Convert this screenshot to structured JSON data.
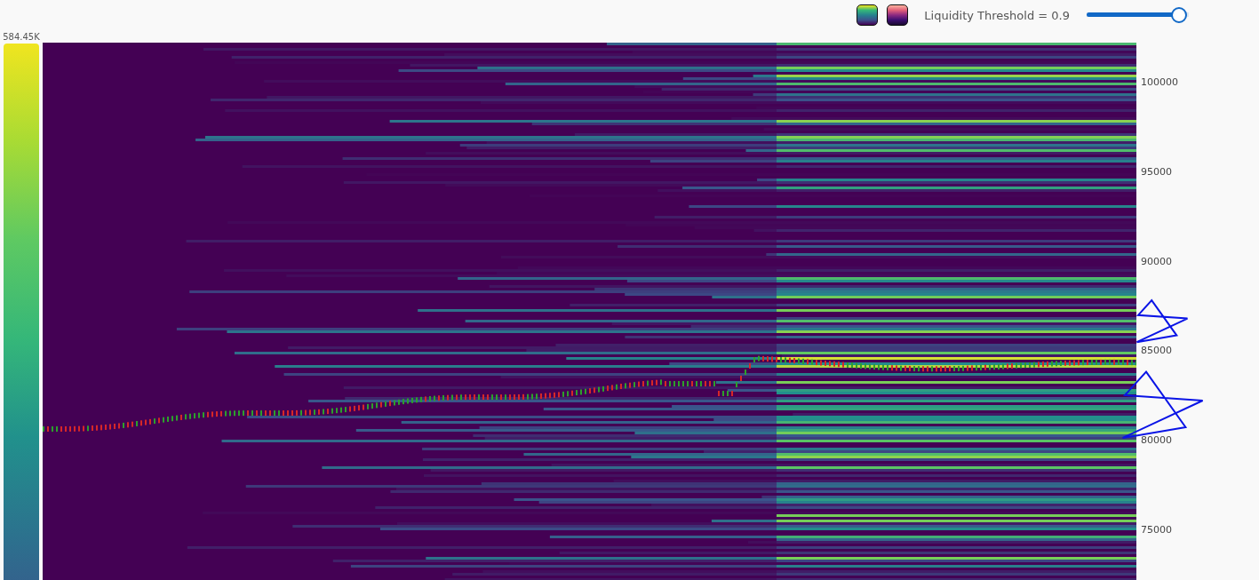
{
  "toolbar": {
    "colormaps": [
      {
        "kind": "viridis"
      },
      {
        "kind": "magma"
      }
    ],
    "slider": {
      "label": "Liquidity Threshold = 0.9",
      "level": 0.9
    }
  },
  "color_scale": {
    "max_label": "584.45K"
  },
  "price_axis": {
    "ticks": [
      "100000",
      "95000",
      "90000",
      "85000",
      "80000",
      "75000"
    ]
  },
  "annotations": [
    {
      "kind": "star"
    },
    {
      "kind": "star"
    }
  ]
}
